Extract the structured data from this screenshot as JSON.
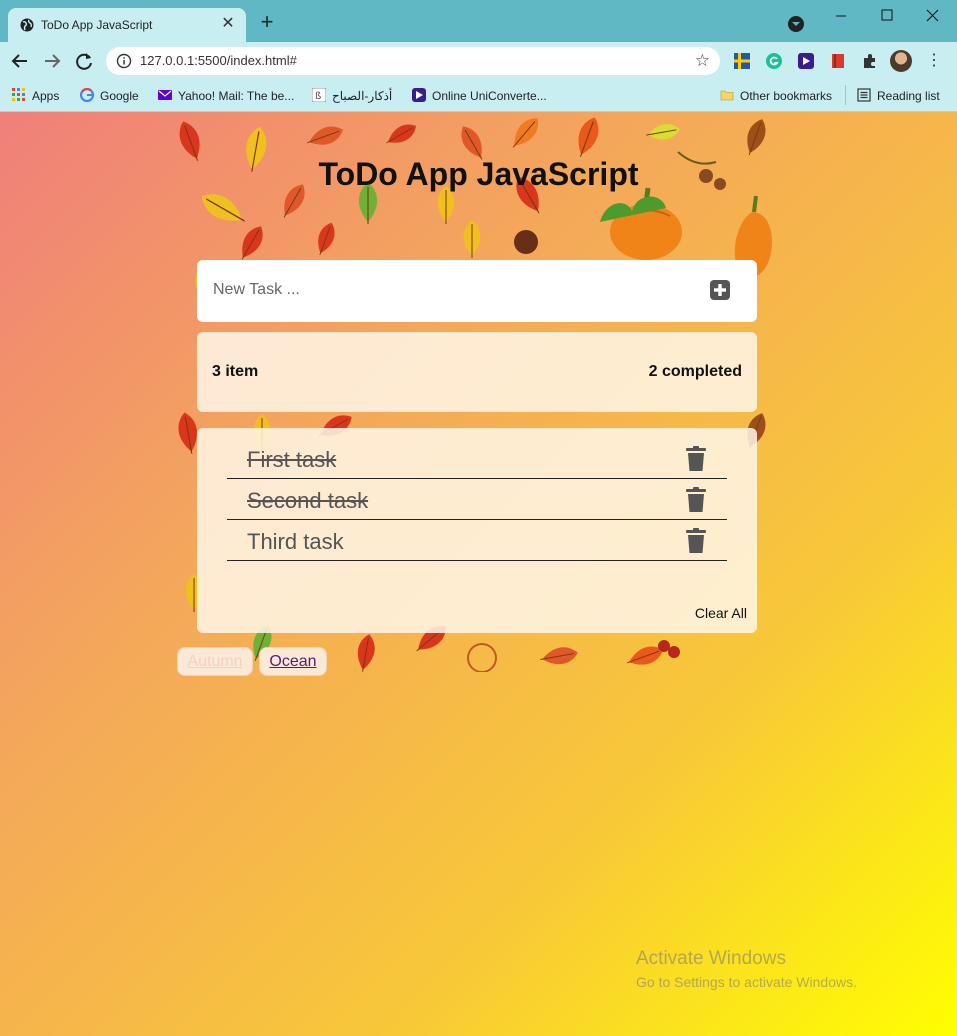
{
  "browser": {
    "tab_title": "ToDo App JavaScript",
    "tab_close": "✕",
    "new_tab": "+",
    "url": "127.0.0.1:5500/index.html#",
    "star": "☆",
    "menu": "⋮",
    "bookmarks": [
      {
        "label": "Apps",
        "icon": "apps-grid-icon"
      },
      {
        "label": "Google",
        "icon": "google-icon"
      },
      {
        "label": "Yahoo! Mail: The be...",
        "icon": "yahoo-mail-icon"
      },
      {
        "label": "أذكار-الصباح",
        "icon": "azkar-icon"
      },
      {
        "label": "Online UniConverte...",
        "icon": "uniconverter-icon"
      }
    ],
    "other_bookmarks": "Other bookmarks",
    "reading_list": "Reading list"
  },
  "app": {
    "title": "ToDo App JavaScript",
    "input_placeholder": "New Task ...",
    "items_count": "3 item",
    "completed_count": "2 completed",
    "todos": [
      {
        "text": "First task",
        "done": true
      },
      {
        "text": "Second task",
        "done": true
      },
      {
        "text": "Third task",
        "done": false
      }
    ],
    "clear_all": "Clear All",
    "themes": [
      "Autumn",
      "Ocean"
    ]
  },
  "watermark": {
    "line1": "Activate Windows",
    "line2": "Go to Settings to activate Windows."
  },
  "colors": {
    "tabstrip": "#5fb8c4",
    "toolbar": "#c9eef1",
    "gradient_start": "#f07f7a",
    "gradient_end": "#ffff00"
  }
}
